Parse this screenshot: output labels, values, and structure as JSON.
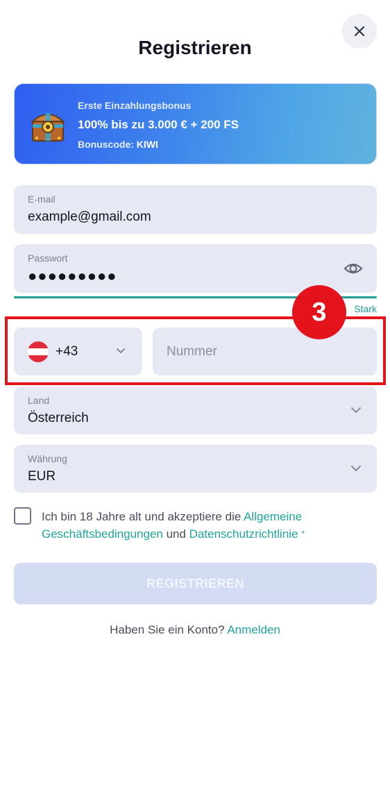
{
  "header": {
    "title": "Registrieren",
    "close_icon": "close-icon"
  },
  "banner": {
    "line1": "Erste Einzahlungsbonus",
    "line2": "100% bis zu 3.000 € + 200 FS",
    "code_label": "Bonuscode: ",
    "code": "KIWI",
    "icon": "treasure-chest-icon"
  },
  "form": {
    "email": {
      "label": "E-mail",
      "value": "example@gmail.com"
    },
    "password": {
      "label": "Passwort",
      "value": "●●●●●●●●●",
      "strength": "Stark",
      "icon": "eye-icon"
    },
    "phone": {
      "country_code": "+43",
      "placeholder": "Nummer",
      "flag": "austria-flag-icon"
    },
    "country": {
      "label": "Land",
      "value": "Österreich"
    },
    "currency": {
      "label": "Währung",
      "value": "EUR"
    },
    "terms": {
      "prefix": "Ich bin 18 Jahre alt und akzeptiere die ",
      "link1": "Allgemeine Geschäftsbedingungen",
      "middle": " und ",
      "link2": "Datenschutzrichtlinie",
      "required": "*"
    },
    "submit_label": "REGISTRIEREN"
  },
  "footer": {
    "question": "Haben Sie ein Konto? ",
    "login_link": "Anmelden"
  },
  "annotation": {
    "step": "3"
  },
  "colors": {
    "accent": "#1f9d94",
    "highlight": "#e3121b",
    "field_bg": "#e6e8f3",
    "button_disabled": "#d4dcf4"
  }
}
